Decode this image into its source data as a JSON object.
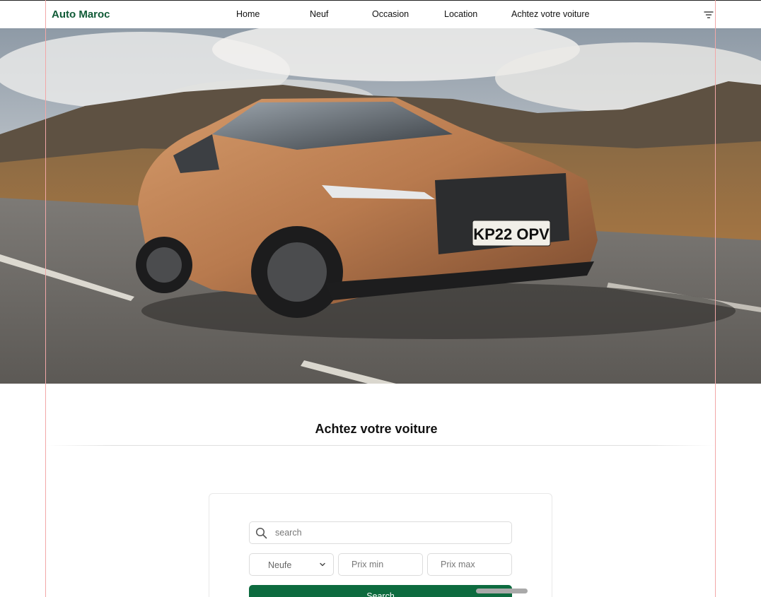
{
  "header": {
    "brand": "Auto Maroc",
    "nav": [
      "Home",
      "Neuf",
      "Occasion",
      "Location",
      "Achtez votre voiture"
    ],
    "menu_icon": "filter-lines-icon"
  },
  "hero": {
    "plate": "KP22 OPV"
  },
  "section": {
    "title": "Achtez votre voiture"
  },
  "search": {
    "placeholder": "search",
    "icon": "search-icon",
    "condition_selected": "Neufe",
    "price_min_placeholder": "Prix min",
    "price_max_placeholder": "Prix max",
    "button_label": "Search"
  },
  "colors": {
    "brand": "#0f5a36",
    "button": "#0d6b3f"
  }
}
